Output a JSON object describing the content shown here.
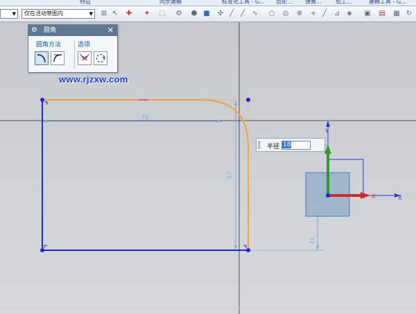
{
  "topbar": {
    "items": [
      "特征",
      "同步建模",
      "标准化工具 - G...",
      "齿轮...",
      "弹簧...",
      "加工...",
      "建模工具 - G..."
    ]
  },
  "toolbar": {
    "combo1_value": "",
    "combo2_value": "仅在活动草图内"
  },
  "fillet_panel": {
    "title": "圆角",
    "group_method": "圆角方法",
    "group_options": "选项"
  },
  "watermark": "www.rjzxw.com",
  "radius_input": {
    "label": "半径",
    "value": "18"
  },
  "dimensions": {
    "horizontal": "78",
    "vertical": "57",
    "offset": "21"
  },
  "axes": {
    "x_label": "X",
    "y_label": "Y"
  },
  "colors": {
    "sketch_blue": "#1d24d6",
    "selected_orange": "#f3a33a",
    "dimension_blue": "#7ea7d8",
    "axis_green": "#2f9a2f",
    "axis_red": "#cc2a2a",
    "axis_blue": "#2a3ad6"
  }
}
